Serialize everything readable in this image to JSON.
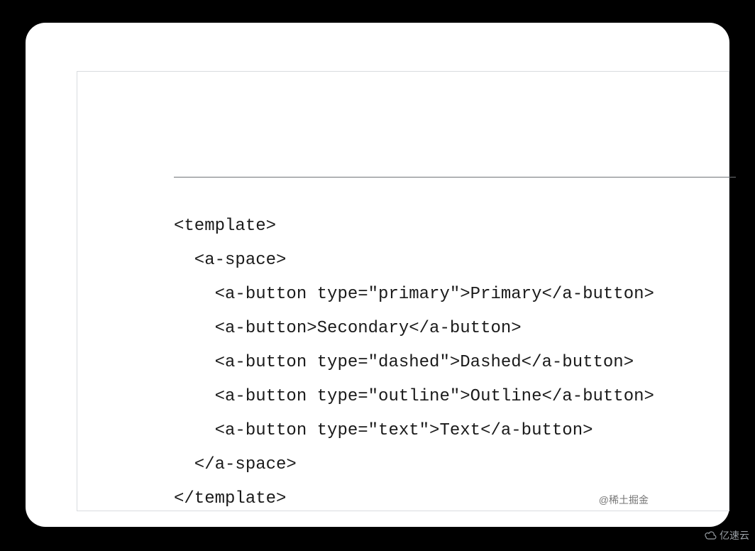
{
  "code_lines": [
    "<template>",
    "  <a-space>",
    "    <a-button type=\"primary\">Primary</a-button>",
    "    <a-button>Secondary</a-button>",
    "    <a-button type=\"dashed\">Dashed</a-button>",
    "    <a-button type=\"outline\">Outline</a-button>",
    "    <a-button type=\"text\">Text</a-button>",
    "  </a-space>",
    "</template>"
  ],
  "watermark_left": "@稀土掘金",
  "watermark_right": "亿速云"
}
